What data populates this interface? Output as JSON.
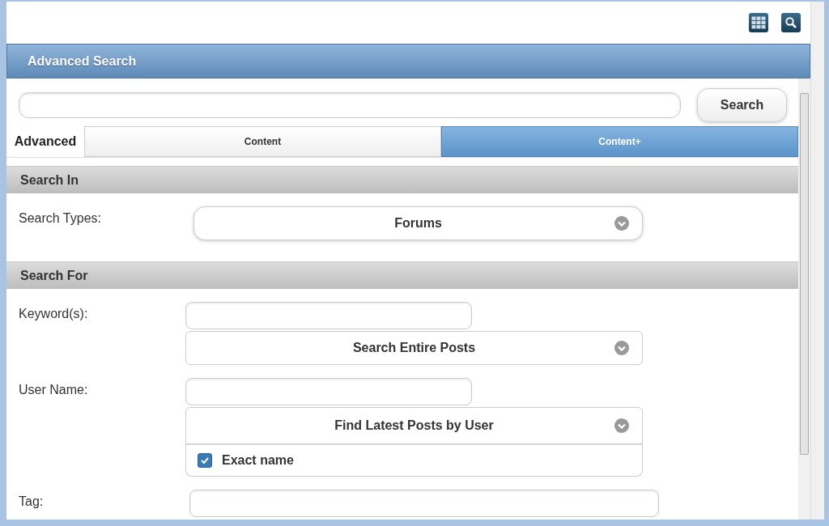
{
  "header": {
    "title": "Advanced Search"
  },
  "search": {
    "button": "Search"
  },
  "tabs_label": "Advanced",
  "tabs": [
    {
      "label": "Content",
      "selected": false
    },
    {
      "label": "Content+",
      "selected": true
    }
  ],
  "sections": [
    {
      "title": "Search In",
      "fields": [
        {
          "kind": "select",
          "label": "Search Types:",
          "value": "Forums"
        }
      ]
    },
    {
      "title": "Search For",
      "fields": [
        {
          "kind": "text-select",
          "label": "Keyword(s):",
          "value": "Search Entire Posts"
        },
        {
          "kind": "text-select-check",
          "label": "User Name:",
          "value": "Find Latest Posts by User",
          "checkbox": {
            "label": "Exact name",
            "checked": true
          }
        },
        {
          "kind": "wide-text",
          "label": "Tag:"
        }
      ]
    }
  ]
}
